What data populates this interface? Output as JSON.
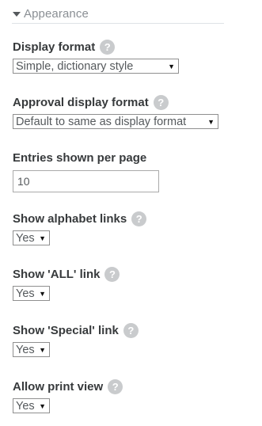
{
  "section": {
    "title": "Appearance"
  },
  "fields": [
    {
      "label": "Display format",
      "help": "?",
      "value": "Simple, dictionary style"
    },
    {
      "label": "Approval display format",
      "help": "?",
      "value": "Default to same as display format"
    },
    {
      "label": "Entries shown per page",
      "value": "10"
    },
    {
      "label": "Show alphabet links",
      "help": "?",
      "value": "Yes"
    },
    {
      "label": "Show 'ALL' link",
      "help": "?",
      "value": "Yes"
    },
    {
      "label": "Show 'Special' link",
      "help": "?",
      "value": "Yes"
    },
    {
      "label": "Allow print view",
      "help": "?",
      "value": "Yes"
    }
  ],
  "icons": {
    "dropdown": "▼",
    "collapse": "caret-down-icon"
  }
}
